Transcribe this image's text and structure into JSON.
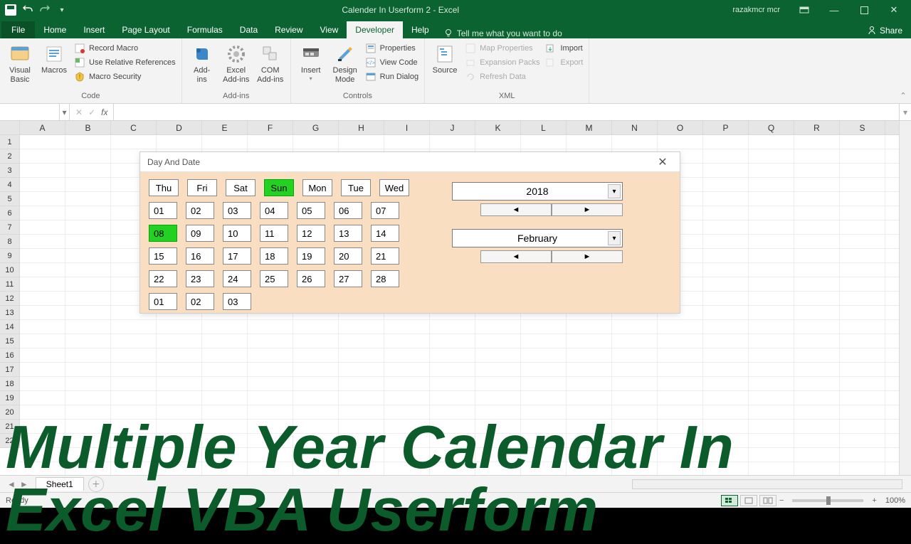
{
  "title": "Calender In Userform 2  -  Excel",
  "user": "razakmcr mcr",
  "menu": {
    "file": "File",
    "tabs": [
      "Home",
      "Insert",
      "Page Layout",
      "Formulas",
      "Data",
      "Review",
      "View",
      "Developer",
      "Help"
    ],
    "active": "Developer",
    "tell": "Tell me what you want to do",
    "share": "Share"
  },
  "ribbon": {
    "code": {
      "visual_basic": "Visual\nBasic",
      "macros": "Macros",
      "record": "Record Macro",
      "relative": "Use Relative References",
      "security": "Macro Security",
      "label": "Code"
    },
    "addins": {
      "addins": "Add-\nins",
      "excel": "Excel\nAdd-ins",
      "com": "COM\nAdd-ins",
      "label": "Add-ins"
    },
    "controls": {
      "insert": "Insert",
      "design": "Design\nMode",
      "properties": "Properties",
      "viewcode": "View Code",
      "rundialog": "Run Dialog",
      "label": "Controls"
    },
    "xml": {
      "source": "Source",
      "map": "Map Properties",
      "expansion": "Expansion Packs",
      "refresh": "Refresh Data",
      "import": "Import",
      "export": "Export",
      "label": "XML"
    }
  },
  "fx": {
    "name": "",
    "symbol": "fx"
  },
  "columns": [
    "A",
    "B",
    "C",
    "D",
    "E",
    "F",
    "G",
    "H",
    "I",
    "J",
    "K",
    "L",
    "M",
    "N",
    "O",
    "P",
    "Q",
    "R",
    "S"
  ],
  "rows": [
    "1",
    "2",
    "3",
    "4",
    "5",
    "6",
    "7",
    "8",
    "9",
    "10",
    "11",
    "12",
    "13",
    "14",
    "15",
    "16",
    "17",
    "18",
    "19",
    "20",
    "21",
    "22"
  ],
  "userform": {
    "title": "Day And Date",
    "days": [
      "Thu",
      "Fri",
      "Sat",
      "Sun",
      "Mon",
      "Tue",
      "Wed"
    ],
    "day_selected": "Sun",
    "weeks": [
      [
        "01",
        "02",
        "03",
        "04",
        "05",
        "06",
        "07"
      ],
      [
        "08",
        "09",
        "10",
        "11",
        "12",
        "13",
        "14"
      ],
      [
        "15",
        "16",
        "17",
        "18",
        "19",
        "20",
        "21"
      ],
      [
        "22",
        "23",
        "24",
        "25",
        "26",
        "27",
        "28"
      ],
      [
        "01",
        "02",
        "03"
      ]
    ],
    "date_selected": "08",
    "year": "2018",
    "month": "February"
  },
  "overlay": {
    "line1": "Multiple Year Calendar In",
    "line2": "Excel VBA Userform"
  },
  "sheet": {
    "tab": "Sheet1"
  },
  "status": {
    "ready": "Ready",
    "zoom": "100%"
  }
}
